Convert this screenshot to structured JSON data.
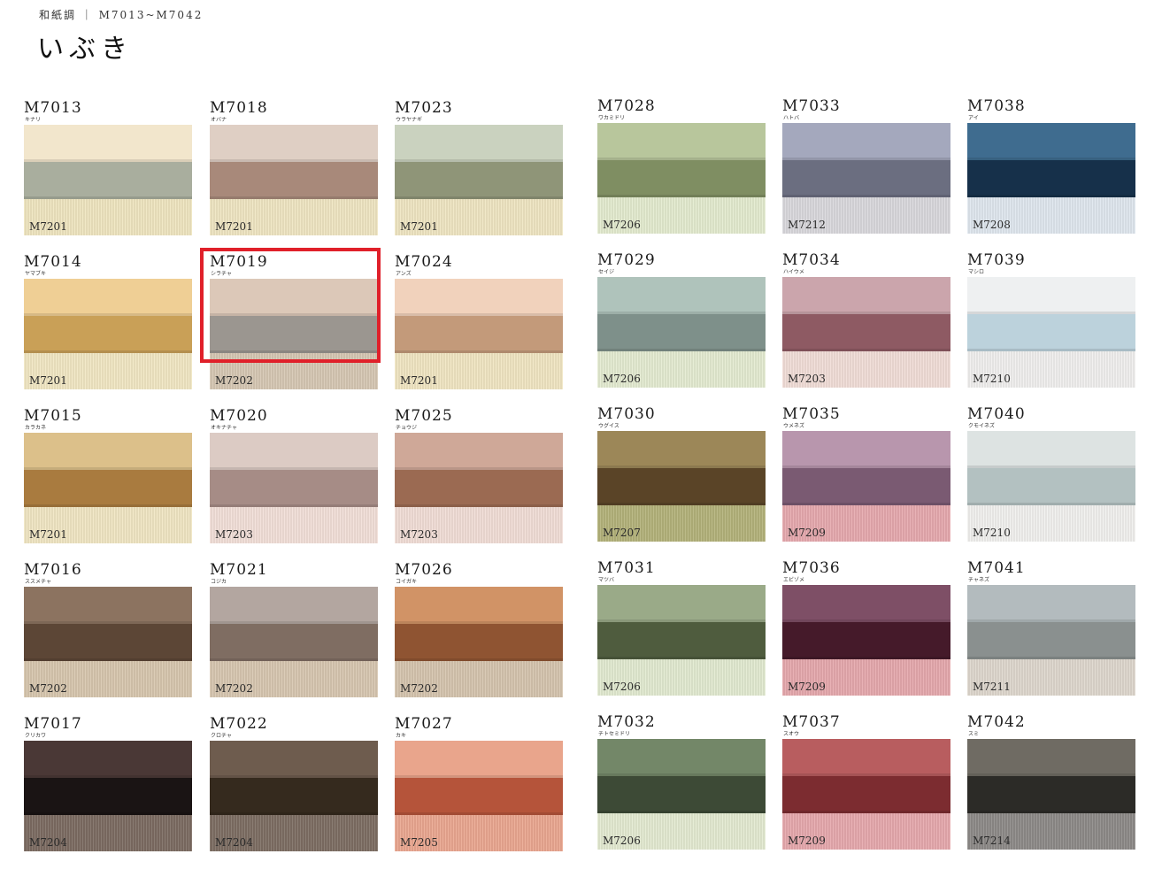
{
  "header": {
    "category": "和紙調 ｜ M7013~M7042",
    "title": "いぶき"
  },
  "swatches": [
    {
      "code": "M7013",
      "kana": "キナリ",
      "liner": "M7201",
      "top": "#f2e6cc",
      "mid": "#a9ae9e",
      "bot": "#efe5c0"
    },
    {
      "code": "M7014",
      "kana": "ヤマブキ",
      "liner": "M7201",
      "top": "#efcf95",
      "mid": "#c9a057",
      "bot": "#f1e7c3"
    },
    {
      "code": "M7015",
      "kana": "カラカネ",
      "liner": "M7201",
      "top": "#dcc08a",
      "mid": "#a97b3f",
      "bot": "#f0e6c3"
    },
    {
      "code": "M7016",
      "kana": "ススメチャ",
      "liner": "M7202",
      "top": "#8c7360",
      "mid": "#5c4636",
      "bot": "#d7c6ae"
    },
    {
      "code": "M7017",
      "kana": "クリカワ",
      "liner": "M7204",
      "top": "#4a3836",
      "mid": "#1a1414",
      "bot": "#7c6c62"
    },
    {
      "code": "M7018",
      "kana": "オバナ",
      "liner": "M7201",
      "top": "#dfcfc4",
      "mid": "#a8897a",
      "bot": "#efe5c2"
    },
    {
      "code": "M7019",
      "kana": "シラチャ",
      "liner": "M7202",
      "top": "#dcc8b8",
      "mid": "#9b9690",
      "bot": "#d6c7b3"
    },
    {
      "code": "M7020",
      "kana": "オキナチャ",
      "liner": "M7203",
      "top": "#dccbc4",
      "mid": "#a68c86",
      "bot": "#f2dfd8"
    },
    {
      "code": "M7021",
      "kana": "コジカ",
      "liner": "M7202",
      "top": "#b3a6a0",
      "mid": "#7f6d62",
      "bot": "#d7c6b0"
    },
    {
      "code": "M7022",
      "kana": "クロチャ",
      "liner": "M7204",
      "top": "#6e5c4e",
      "mid": "#352a1e",
      "bot": "#7d6e63"
    },
    {
      "code": "M7023",
      "kana": "ウラヤナギ",
      "liner": "M7201",
      "top": "#cad2bf",
      "mid": "#8f9578",
      "bot": "#efe5c2"
    },
    {
      "code": "M7024",
      "kana": "アンズ",
      "liner": "M7201",
      "top": "#f1d2bc",
      "mid": "#c39a7a",
      "bot": "#f0e5c2"
    },
    {
      "code": "M7025",
      "kana": "チョウジ",
      "liner": "M7203",
      "top": "#cfa898",
      "mid": "#9b6a52",
      "bot": "#f1ddd6"
    },
    {
      "code": "M7026",
      "kana": "コイガキ",
      "liner": "M7202",
      "top": "#d19366",
      "mid": "#8f5432",
      "bot": "#d5c4ae"
    },
    {
      "code": "M7027",
      "kana": "カキ",
      "liner": "M7205",
      "top": "#e9a58c",
      "mid": "#b5543a",
      "bot": "#eaa790"
    },
    {
      "code": "M7028",
      "kana": "ワカミドリ",
      "liner": "M7206",
      "top": "#b8c69c",
      "mid": "#7f8e62",
      "bot": "#e3ebcf"
    },
    {
      "code": "M7029",
      "kana": "セイジ",
      "liner": "M7206",
      "top": "#afc3bb",
      "mid": "#7e908a",
      "bot": "#e4ebd1"
    },
    {
      "code": "M7030",
      "kana": "ウグイス",
      "liner": "M7207",
      "top": "#9c8758",
      "mid": "#5a4427",
      "bot": "#b3b27a"
    },
    {
      "code": "M7031",
      "kana": "マツバ",
      "liner": "M7206",
      "top": "#9aaa88",
      "mid": "#4f5c3e",
      "bot": "#e2ead0"
    },
    {
      "code": "M7032",
      "kana": "チトセミドリ",
      "liner": "M7206",
      "top": "#738768",
      "mid": "#3d4a36",
      "bot": "#e3ead1"
    },
    {
      "code": "M7033",
      "kana": "ハトバ",
      "liner": "M7212",
      "top": "#a4a8bd",
      "mid": "#6b6e80",
      "bot": "#d9d8dc"
    },
    {
      "code": "M7034",
      "kana": "ハイウメ",
      "liner": "M7203",
      "top": "#cba5ac",
      "mid": "#8e5a63",
      "bot": "#f1ddd7"
    },
    {
      "code": "M7035",
      "kana": "ウメネズ",
      "liner": "M7209",
      "top": "#b896ad",
      "mid": "#7a5a72",
      "bot": "#e6a9ae"
    },
    {
      "code": "M7036",
      "kana": "エビゾメ",
      "liner": "M7209",
      "top": "#7e4f66",
      "mid": "#451a2a",
      "bot": "#e5a8ad"
    },
    {
      "code": "M7037",
      "kana": "スオウ",
      "liner": "M7209",
      "top": "#b85d5f",
      "mid": "#7c2c30",
      "bot": "#e6a8ad"
    },
    {
      "code": "M7038",
      "kana": "アイ",
      "liner": "M7208",
      "top": "#3f6c8f",
      "mid": "#16304a",
      "bot": "#dfe7ee"
    },
    {
      "code": "M7039",
      "kana": "マシロ",
      "liner": "M7210",
      "top": "#eef0f1",
      "mid": "#bcd2dc",
      "bot": "#f0efee"
    },
    {
      "code": "M7040",
      "kana": "クモイネズ",
      "liner": "M7210",
      "top": "#dde3e2",
      "mid": "#b3c1c1",
      "bot": "#f1f0ee"
    },
    {
      "code": "M7041",
      "kana": "チャネズ",
      "liner": "M7211",
      "top": "#b3bbbe",
      "mid": "#8a908f",
      "bot": "#ded7cd"
    },
    {
      "code": "M7042",
      "kana": "スミ",
      "liner": "M7214",
      "top": "#6f6b63",
      "mid": "#2c2b27",
      "bot": "#8d8a88"
    }
  ],
  "highlighted": "M7019"
}
